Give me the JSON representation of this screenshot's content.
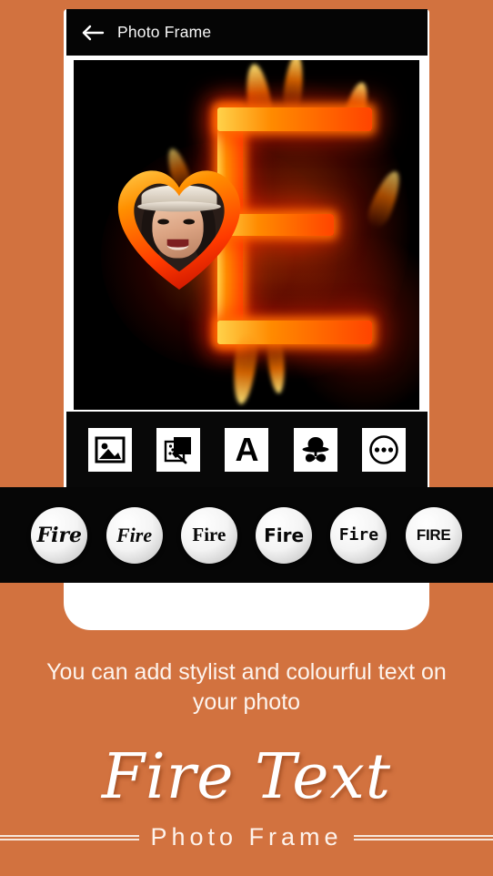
{
  "theme": {
    "background_color": "#d2723f",
    "panel_color": "#060606",
    "phone_body_color": "#ffffff",
    "text_color": "#fdf4ee"
  },
  "header": {
    "back_icon": "back-arrow-icon",
    "title": "Photo Frame"
  },
  "canvas": {
    "artwork_description": "Burning letter E with a fire heart photo frame",
    "letter": "E",
    "photo_subject": "Smiling woman wearing a white hat"
  },
  "toolbar": {
    "items": [
      {
        "name": "gallery",
        "icon": "image-icon",
        "label": "Gallery"
      },
      {
        "name": "effects",
        "icon": "effects-wand-icon",
        "label": "Effects"
      },
      {
        "name": "text",
        "icon": "text-a-icon",
        "label": "A"
      },
      {
        "name": "stickers",
        "icon": "hat-mustache-icon",
        "label": "Stickers"
      },
      {
        "name": "more",
        "icon": "more-dots-icon",
        "label": "More"
      }
    ]
  },
  "font_strip": {
    "options": [
      {
        "label": "Fire",
        "style": "script-bold-italic"
      },
      {
        "label": "Fire",
        "style": "serif-italic"
      },
      {
        "label": "Fire",
        "style": "serif-bold"
      },
      {
        "label": "Fire",
        "style": "sans-bold"
      },
      {
        "label": "Fire",
        "style": "mono-bold"
      },
      {
        "label": "FIRE",
        "style": "sans-uppercase"
      }
    ]
  },
  "promo": {
    "tagline": "You can add stylist and colourful text on your photo"
  },
  "brand": {
    "title": "Fire Text",
    "subtitle": "Photo Frame"
  }
}
